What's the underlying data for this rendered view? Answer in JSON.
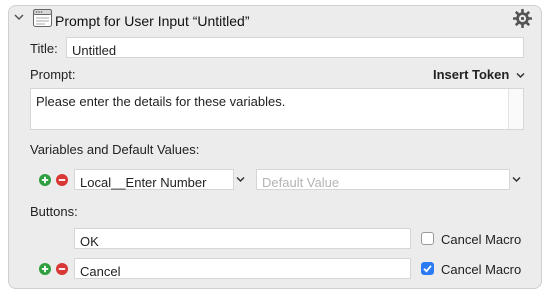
{
  "header": {
    "title": "Prompt for User Input “Untitled”",
    "collapse_icon": "chevron-down-icon",
    "app_icon": "window-icon",
    "settings_icon": "gear-icon"
  },
  "title_field": {
    "label": "Title:",
    "value": "Untitled"
  },
  "prompt_field": {
    "label": "Prompt:",
    "insert_token_label": "Insert Token",
    "value": "Please enter the details for these variables."
  },
  "variables": {
    "section_label": "Variables and Default Values:",
    "rows": [
      {
        "name": "Local__Enter Number",
        "default_value": "",
        "default_placeholder": "Default Value"
      }
    ]
  },
  "buttons": {
    "section_label": "Buttons:",
    "rows": [
      {
        "label": "OK",
        "cancel_label": "Cancel Macro",
        "cancel_checked": false
      },
      {
        "label": "Cancel",
        "cancel_label": "Cancel Macro",
        "cancel_checked": true
      }
    ]
  },
  "colors": {
    "accent": "#2b7bf5",
    "add": "#2f9e3f",
    "remove": "#d93636"
  }
}
